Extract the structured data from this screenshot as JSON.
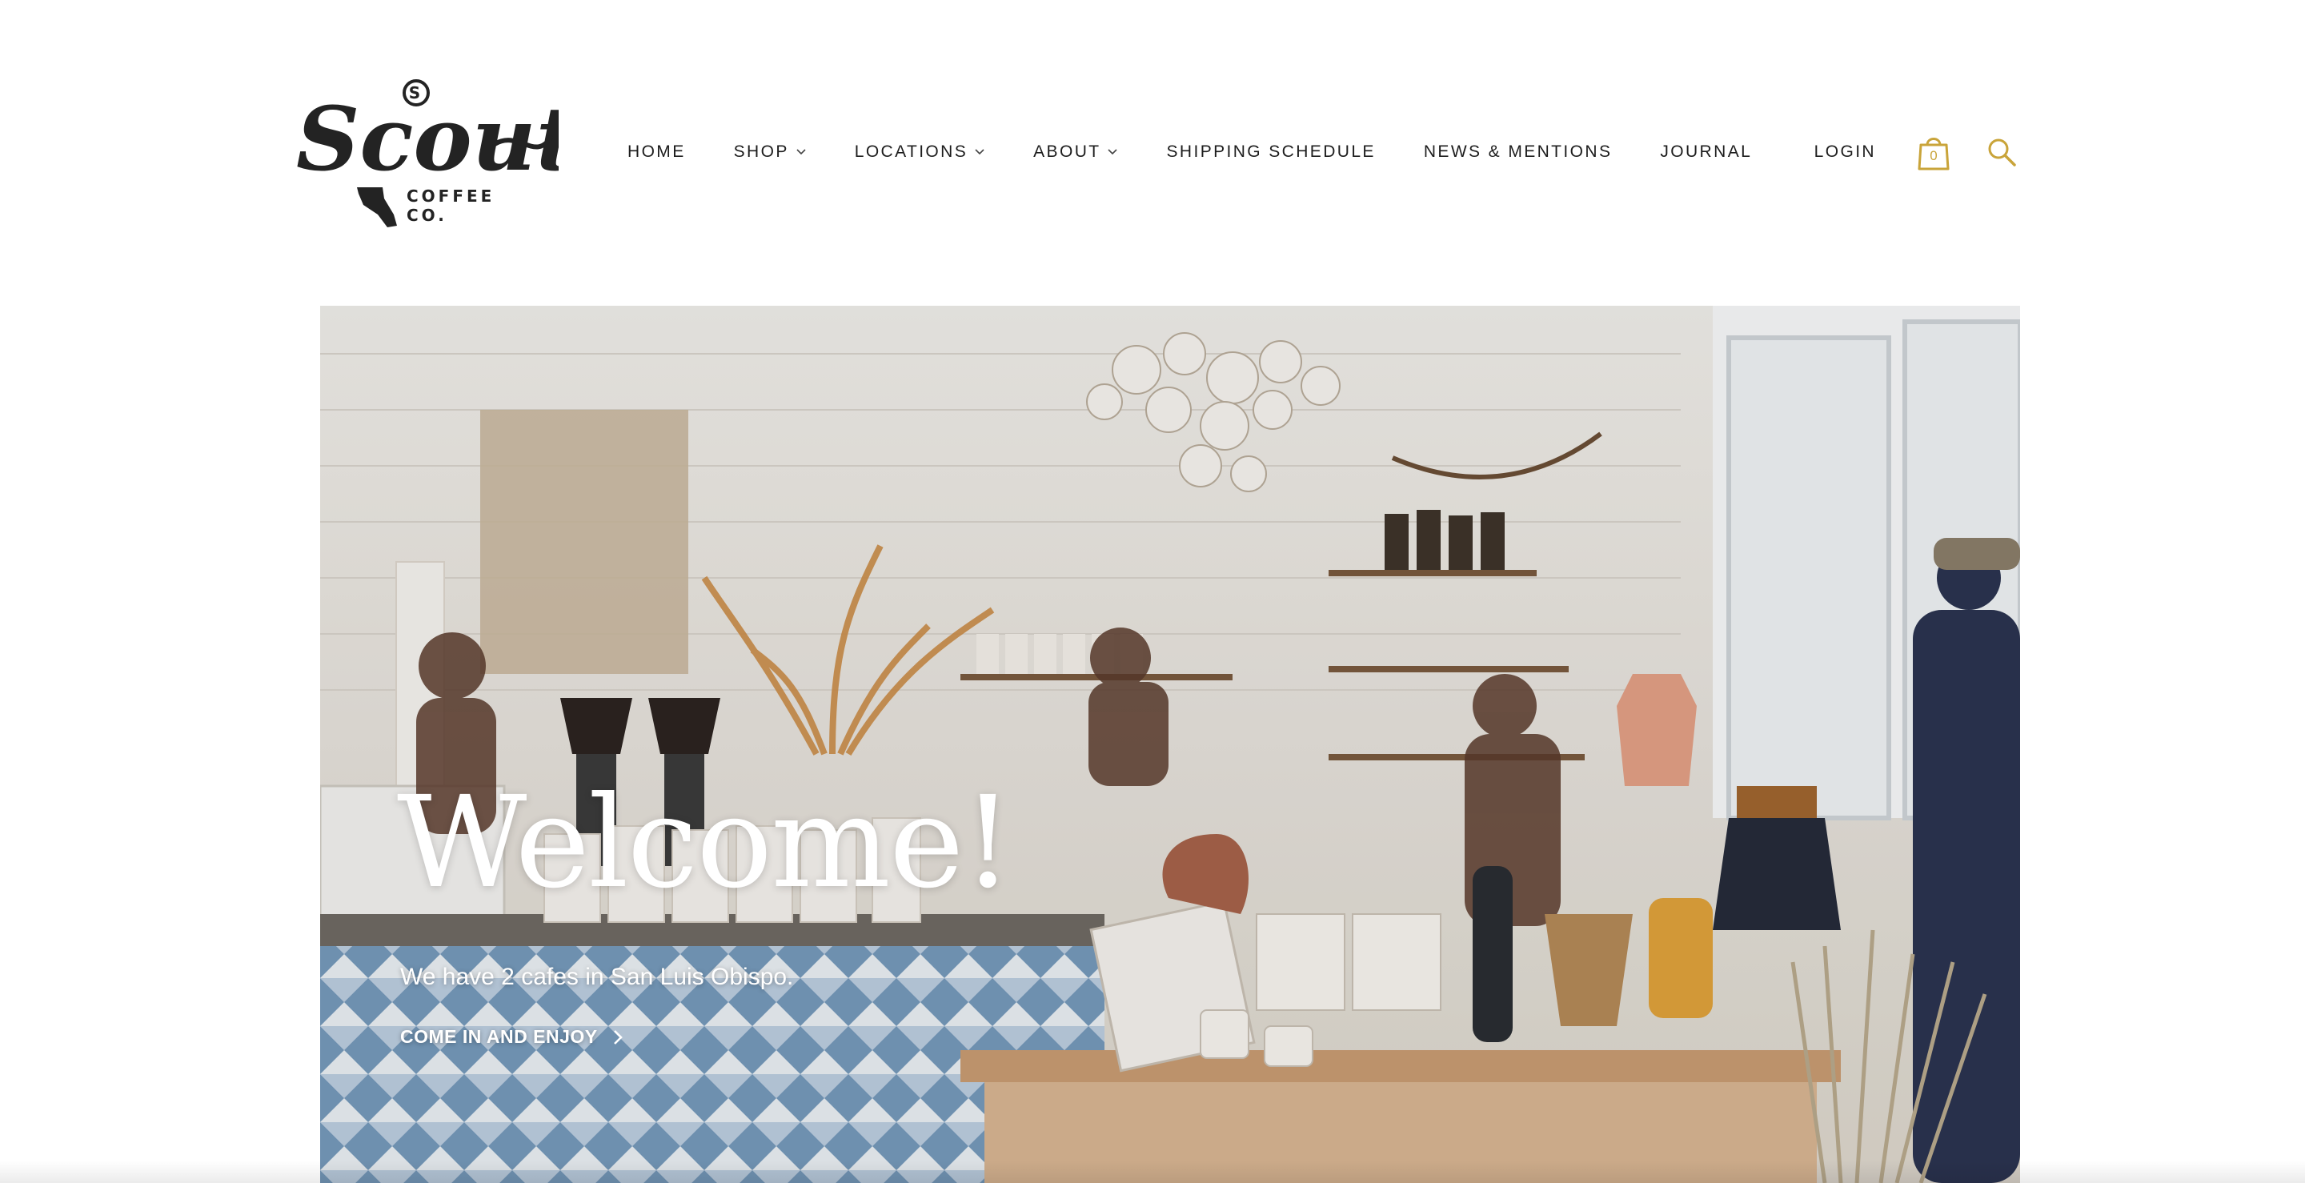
{
  "brand": {
    "script": "Scout",
    "badge": "S",
    "sub_line1": "COFFEE",
    "sub_line2": "CO."
  },
  "nav": {
    "home": "HOME",
    "shop": "SHOP",
    "locations": "LOCATIONS",
    "about": "ABOUT",
    "shipping": "SHIPPING SCHEDULE",
    "news": "NEWS & MENTIONS",
    "journal": "JOURNAL"
  },
  "utility": {
    "login": "LOGIN",
    "cart_count": "0",
    "cart_icon": "shopping-bag-icon",
    "search_icon": "search-icon"
  },
  "hero": {
    "title": "Welcome!",
    "subtitle": "We have 2 cafes in San Luis Obispo.",
    "cta": "COME IN AND ENJOY"
  },
  "colors": {
    "accent": "#c9a43a",
    "text": "#1d1d1d",
    "hero_text": "#ffffff"
  }
}
